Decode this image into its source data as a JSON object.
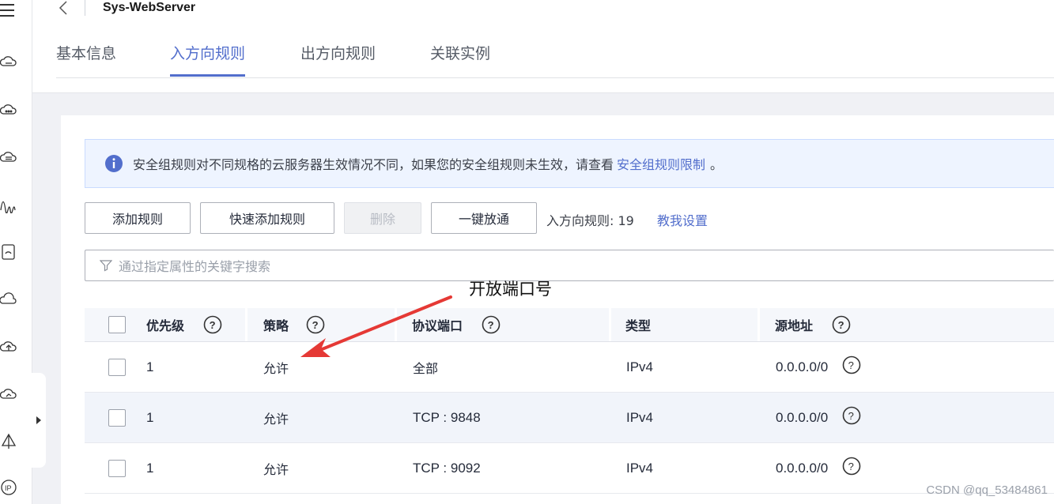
{
  "header": {
    "title": "Sys-WebServer",
    "tabs": [
      {
        "label": "基本信息",
        "active": false
      },
      {
        "label": "入方向规则",
        "active": true
      },
      {
        "label": "出方向规则",
        "active": false
      },
      {
        "label": "关联实例",
        "active": false
      }
    ]
  },
  "notice": {
    "text": "安全组规则对不同规格的云服务器生效情况不同，如果您的安全组规则未生效，请查看",
    "link": "安全组规则限制",
    "suffix": "。"
  },
  "toolbar": {
    "add_rule": "添加规则",
    "quick_add": "快速添加规则",
    "delete": "删除",
    "one_click": "一键放通",
    "rule_count": "入方向规则: 19",
    "help_link": "教我设置"
  },
  "search": {
    "placeholder": "通过指定属性的关键字搜索"
  },
  "annotation": {
    "text": "开放端口号",
    "color": "#e53935"
  },
  "table": {
    "columns": [
      "优先级",
      "策略",
      "协议端口",
      "类型",
      "源地址"
    ],
    "rows": [
      {
        "priority": "1",
        "policy": "允许",
        "port": "全部",
        "type": "IPv4",
        "source": "0.0.0.0/0"
      },
      {
        "priority": "1",
        "policy": "允许",
        "port": "TCP : 9848",
        "type": "IPv4",
        "source": "0.0.0.0/0"
      },
      {
        "priority": "1",
        "policy": "允许",
        "port": "TCP : 9092",
        "type": "IPv4",
        "source": "0.0.0.0/0"
      }
    ]
  },
  "watermark": "CSDN @qq_53484861",
  "colors": {
    "accent": "#526ecc",
    "notice_bg": "#eef4ff",
    "row_alt": "#f1f4fa"
  }
}
